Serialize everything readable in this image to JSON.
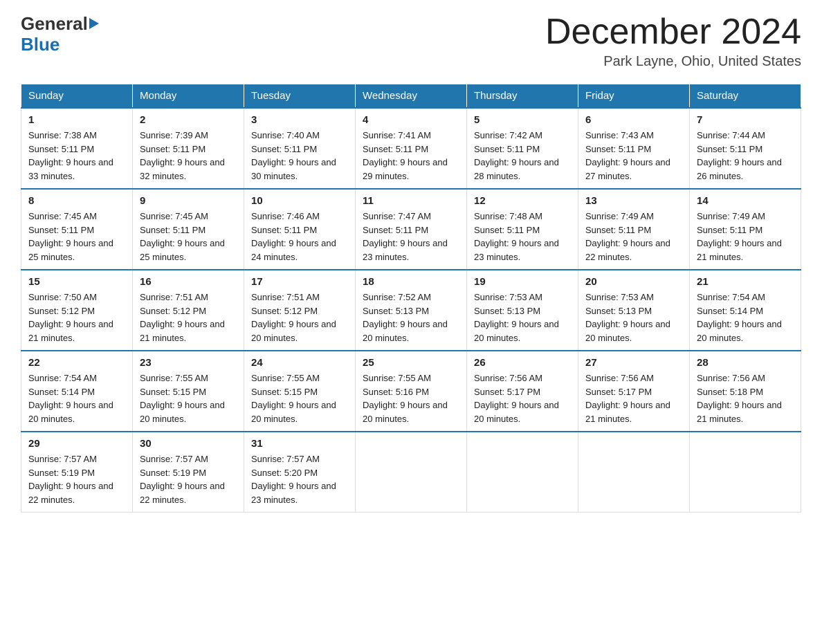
{
  "logo": {
    "text_general": "General",
    "text_blue": "Blue",
    "arrow": "▶"
  },
  "header": {
    "month": "December 2024",
    "location": "Park Layne, Ohio, United States"
  },
  "days_of_week": [
    "Sunday",
    "Monday",
    "Tuesday",
    "Wednesday",
    "Thursday",
    "Friday",
    "Saturday"
  ],
  "weeks": [
    [
      {
        "num": "1",
        "sunrise": "7:38 AM",
        "sunset": "5:11 PM",
        "daylight": "9 hours and 33 minutes."
      },
      {
        "num": "2",
        "sunrise": "7:39 AM",
        "sunset": "5:11 PM",
        "daylight": "9 hours and 32 minutes."
      },
      {
        "num": "3",
        "sunrise": "7:40 AM",
        "sunset": "5:11 PM",
        "daylight": "9 hours and 30 minutes."
      },
      {
        "num": "4",
        "sunrise": "7:41 AM",
        "sunset": "5:11 PM",
        "daylight": "9 hours and 29 minutes."
      },
      {
        "num": "5",
        "sunrise": "7:42 AM",
        "sunset": "5:11 PM",
        "daylight": "9 hours and 28 minutes."
      },
      {
        "num": "6",
        "sunrise": "7:43 AM",
        "sunset": "5:11 PM",
        "daylight": "9 hours and 27 minutes."
      },
      {
        "num": "7",
        "sunrise": "7:44 AM",
        "sunset": "5:11 PM",
        "daylight": "9 hours and 26 minutes."
      }
    ],
    [
      {
        "num": "8",
        "sunrise": "7:45 AM",
        "sunset": "5:11 PM",
        "daylight": "9 hours and 25 minutes."
      },
      {
        "num": "9",
        "sunrise": "7:45 AM",
        "sunset": "5:11 PM",
        "daylight": "9 hours and 25 minutes."
      },
      {
        "num": "10",
        "sunrise": "7:46 AM",
        "sunset": "5:11 PM",
        "daylight": "9 hours and 24 minutes."
      },
      {
        "num": "11",
        "sunrise": "7:47 AM",
        "sunset": "5:11 PM",
        "daylight": "9 hours and 23 minutes."
      },
      {
        "num": "12",
        "sunrise": "7:48 AM",
        "sunset": "5:11 PM",
        "daylight": "9 hours and 23 minutes."
      },
      {
        "num": "13",
        "sunrise": "7:49 AM",
        "sunset": "5:11 PM",
        "daylight": "9 hours and 22 minutes."
      },
      {
        "num": "14",
        "sunrise": "7:49 AM",
        "sunset": "5:11 PM",
        "daylight": "9 hours and 21 minutes."
      }
    ],
    [
      {
        "num": "15",
        "sunrise": "7:50 AM",
        "sunset": "5:12 PM",
        "daylight": "9 hours and 21 minutes."
      },
      {
        "num": "16",
        "sunrise": "7:51 AM",
        "sunset": "5:12 PM",
        "daylight": "9 hours and 21 minutes."
      },
      {
        "num": "17",
        "sunrise": "7:51 AM",
        "sunset": "5:12 PM",
        "daylight": "9 hours and 20 minutes."
      },
      {
        "num": "18",
        "sunrise": "7:52 AM",
        "sunset": "5:13 PM",
        "daylight": "9 hours and 20 minutes."
      },
      {
        "num": "19",
        "sunrise": "7:53 AM",
        "sunset": "5:13 PM",
        "daylight": "9 hours and 20 minutes."
      },
      {
        "num": "20",
        "sunrise": "7:53 AM",
        "sunset": "5:13 PM",
        "daylight": "9 hours and 20 minutes."
      },
      {
        "num": "21",
        "sunrise": "7:54 AM",
        "sunset": "5:14 PM",
        "daylight": "9 hours and 20 minutes."
      }
    ],
    [
      {
        "num": "22",
        "sunrise": "7:54 AM",
        "sunset": "5:14 PM",
        "daylight": "9 hours and 20 minutes."
      },
      {
        "num": "23",
        "sunrise": "7:55 AM",
        "sunset": "5:15 PM",
        "daylight": "9 hours and 20 minutes."
      },
      {
        "num": "24",
        "sunrise": "7:55 AM",
        "sunset": "5:15 PM",
        "daylight": "9 hours and 20 minutes."
      },
      {
        "num": "25",
        "sunrise": "7:55 AM",
        "sunset": "5:16 PM",
        "daylight": "9 hours and 20 minutes."
      },
      {
        "num": "26",
        "sunrise": "7:56 AM",
        "sunset": "5:17 PM",
        "daylight": "9 hours and 20 minutes."
      },
      {
        "num": "27",
        "sunrise": "7:56 AM",
        "sunset": "5:17 PM",
        "daylight": "9 hours and 21 minutes."
      },
      {
        "num": "28",
        "sunrise": "7:56 AM",
        "sunset": "5:18 PM",
        "daylight": "9 hours and 21 minutes."
      }
    ],
    [
      {
        "num": "29",
        "sunrise": "7:57 AM",
        "sunset": "5:19 PM",
        "daylight": "9 hours and 22 minutes."
      },
      {
        "num": "30",
        "sunrise": "7:57 AM",
        "sunset": "5:19 PM",
        "daylight": "9 hours and 22 minutes."
      },
      {
        "num": "31",
        "sunrise": "7:57 AM",
        "sunset": "5:20 PM",
        "daylight": "9 hours and 23 minutes."
      },
      null,
      null,
      null,
      null
    ]
  ]
}
